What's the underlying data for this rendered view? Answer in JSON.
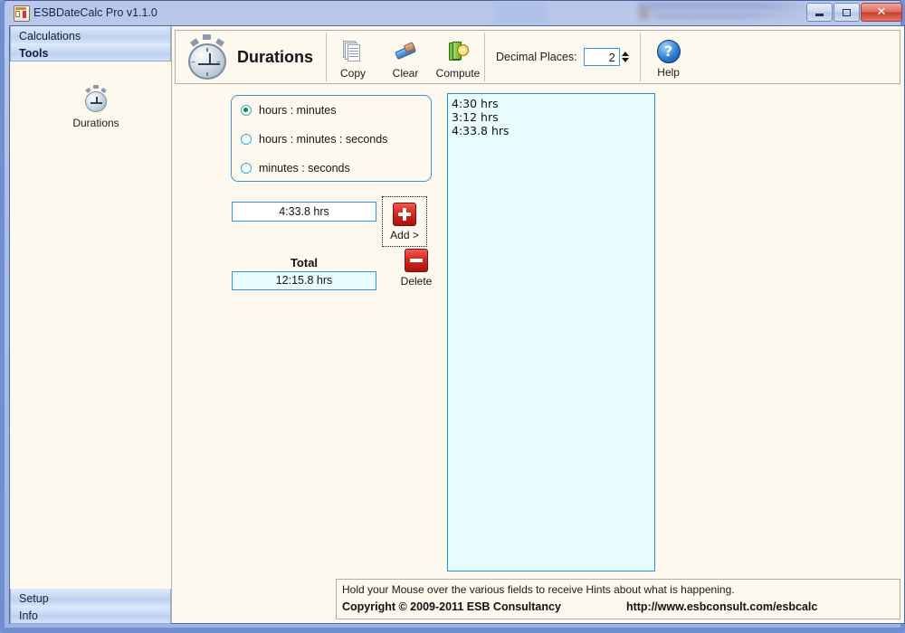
{
  "window": {
    "title": "ESBDateCalc Pro v1.1.0",
    "icon": "app-icon",
    "buttons": {
      "minimize": "minimize-button",
      "maximize": "maximize-button",
      "close": "✕"
    }
  },
  "sidebar": {
    "headers": [
      {
        "label": "Calculations",
        "selected": false
      },
      {
        "label": "Tools",
        "selected": true
      }
    ],
    "items": [
      {
        "label": "Durations",
        "icon": "stopwatch-icon"
      }
    ],
    "footers": [
      {
        "label": "Setup"
      },
      {
        "label": "Info"
      }
    ]
  },
  "toolbar": {
    "title": "Durations",
    "title_icon": "stopwatch-icon",
    "buttons": [
      {
        "label": "Copy",
        "icon": "copy-icon"
      },
      {
        "label": "Clear",
        "icon": "eraser-icon"
      },
      {
        "label": "Compute",
        "icon": "compute-icon"
      }
    ],
    "decimal_places": {
      "label": "Decimal Places:",
      "value": "2"
    },
    "help": {
      "label": "Help",
      "icon": "help-icon"
    }
  },
  "main": {
    "format_options": [
      {
        "label": "hours : minutes",
        "selected": true
      },
      {
        "label": "hours : minutes : seconds",
        "selected": false
      },
      {
        "label": "minutes : seconds",
        "selected": false
      }
    ],
    "duration_input": {
      "value": "4:33.8 hrs",
      "placeholder": ""
    },
    "add_button": {
      "label": "Add >",
      "icon": "plus-icon"
    },
    "delete_button": {
      "label": "Delete",
      "icon": "minus-icon"
    },
    "total_label": "Total",
    "total_value": "12:15.8 hrs",
    "list_items": [
      "4:30 hrs",
      "3:12 hrs",
      "4:33.8 hrs"
    ]
  },
  "status": {
    "hint": "Hold your Mouse over the various fields to receive Hints about what is happening.",
    "copyright": "Copyright © 2009-2011 ESB Consultancy",
    "url": "http://www.esbconsult.com/esbcalc"
  },
  "colors": {
    "accent_blue": "#3b93e0",
    "window_bg": "#fdf9ef",
    "list_bg": "#e9fdff",
    "title_gradient_start": "#b9c8ea",
    "close_red": "#c93d2f",
    "button_red": "#d32a22",
    "radio_dot_green": "#1a8a1a"
  }
}
